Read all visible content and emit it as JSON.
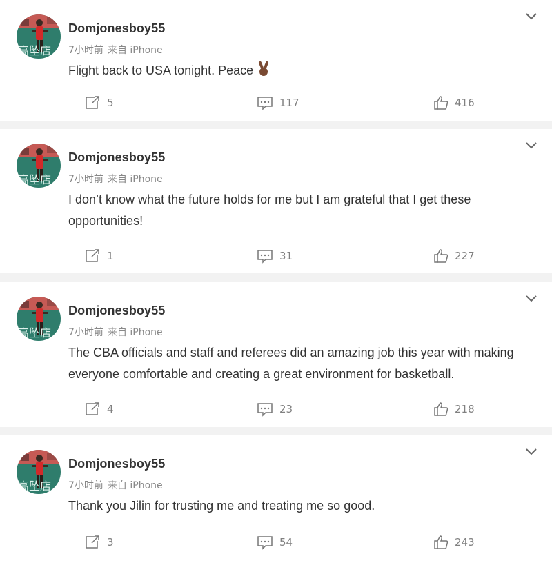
{
  "posts": [
    {
      "username": "Domjonesboy55",
      "time": "7小时前",
      "source": "来自 iPhone",
      "text": "Flight back to USA tonight. Peace",
      "emoji": "victory-hand",
      "reposts": "5",
      "comments": "117",
      "likes": "416"
    },
    {
      "username": "Domjonesboy55",
      "time": "7小时前",
      "source": "来自 iPhone",
      "text": "I don’t know what the future holds for me but I am grateful that I get these opportunities!",
      "reposts": "1",
      "comments": "31",
      "likes": "227"
    },
    {
      "username": "Domjonesboy55",
      "time": "7小时前",
      "source": "来自 iPhone",
      "text": "The CBA officials and staff and referees did an amazing job this year with making everyone comfortable and creating a great environment for basketball.",
      "reposts": "4",
      "comments": "23",
      "likes": "218"
    },
    {
      "username": "Domjonesboy55",
      "time": "7小时前",
      "source": "来自 iPhone",
      "text": "Thank you Jilin for trusting me and treating me so good.",
      "reposts": "3",
      "comments": "54",
      "likes": "243"
    }
  ],
  "avatar": {
    "caption": "高坠店"
  },
  "icons": {
    "more": "chevron-down-icon",
    "repost": "repost-icon",
    "comment": "comment-icon",
    "like": "thumbs-up-icon"
  },
  "colors": {
    "background": "#f2f2f2",
    "card": "#ffffff",
    "text": "#333333",
    "meta": "#888888",
    "action": "#808080",
    "avatar_bg": "#2f7d6c",
    "jersey": "#d12a2a"
  }
}
